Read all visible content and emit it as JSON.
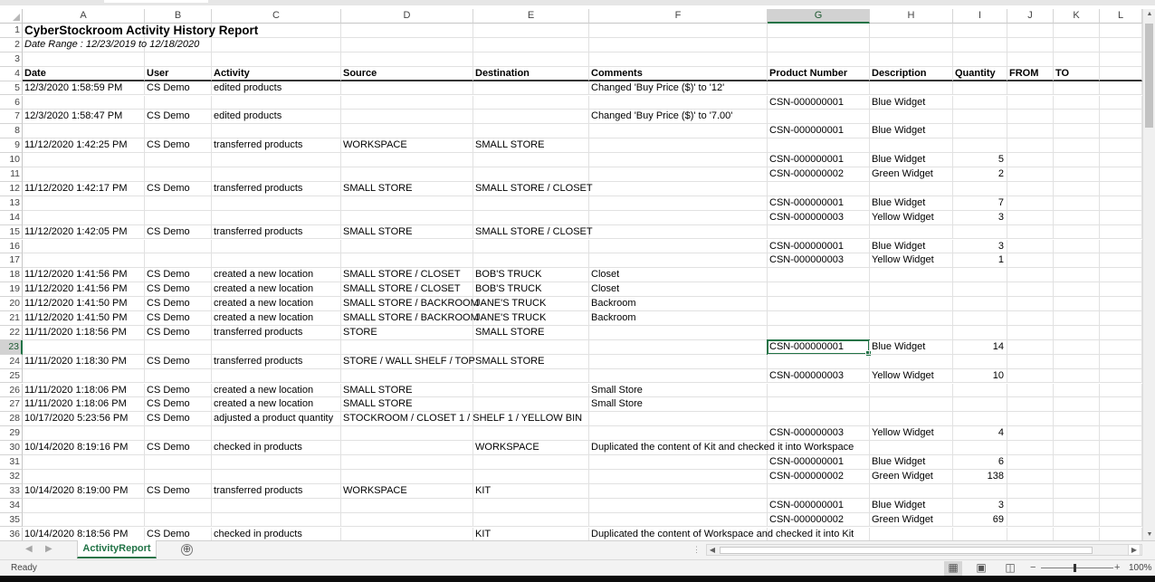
{
  "columns": [
    "A",
    "B",
    "C",
    "D",
    "E",
    "F",
    "G",
    "H",
    "I",
    "J",
    "K",
    "L"
  ],
  "rows": [
    [
      "CyberStockroom Activity History Report",
      "",
      "",
      "",
      "",
      "",
      "",
      "",
      "",
      "",
      "",
      ""
    ],
    [
      "Date Range : 12/23/2019 to 12/18/2020",
      "",
      "",
      "",
      "",
      "",
      "",
      "",
      "",
      "",
      "",
      ""
    ],
    [
      "",
      "",
      "",
      "",
      "",
      "",
      "",
      "",
      "",
      "",
      "",
      ""
    ],
    [
      "Date",
      "User",
      "Activity",
      "Source",
      "Destination",
      "Comments",
      "Product Number",
      "Description",
      "Quantity",
      "FROM",
      "TO",
      ""
    ],
    [
      "12/3/2020 1:58:59 PM",
      "CS Demo",
      "edited products",
      "",
      "",
      "Changed 'Buy Price ($)' to '12'",
      "",
      "",
      "",
      "",
      "",
      ""
    ],
    [
      "",
      "",
      "",
      "",
      "",
      "",
      "CSN-000000001",
      "Blue Widget",
      "",
      "",
      "",
      ""
    ],
    [
      "12/3/2020 1:58:47 PM",
      "CS Demo",
      "edited products",
      "",
      "",
      "Changed 'Buy Price ($)' to '7.00'",
      "",
      "",
      "",
      "",
      "",
      ""
    ],
    [
      "",
      "",
      "",
      "",
      "",
      "",
      "CSN-000000001",
      "Blue Widget",
      "",
      "",
      "",
      ""
    ],
    [
      "11/12/2020 1:42:25 PM",
      "CS Demo",
      "transferred products",
      "WORKSPACE",
      "SMALL STORE",
      "",
      "",
      "",
      "",
      "",
      "",
      ""
    ],
    [
      "",
      "",
      "",
      "",
      "",
      "",
      "CSN-000000001",
      "Blue Widget",
      "5",
      "",
      "",
      ""
    ],
    [
      "",
      "",
      "",
      "",
      "",
      "",
      "CSN-000000002",
      "Green Widget",
      "2",
      "",
      "",
      ""
    ],
    [
      "11/12/2020 1:42:17 PM",
      "CS Demo",
      "transferred products",
      "SMALL STORE",
      "SMALL STORE / CLOSET",
      "",
      "",
      "",
      "",
      "",
      "",
      ""
    ],
    [
      "",
      "",
      "",
      "",
      "",
      "",
      "CSN-000000001",
      "Blue Widget",
      "7",
      "",
      "",
      ""
    ],
    [
      "",
      "",
      "",
      "",
      "",
      "",
      "CSN-000000003",
      "Yellow Widget",
      "3",
      "",
      "",
      ""
    ],
    [
      "11/12/2020 1:42:05 PM",
      "CS Demo",
      "transferred products",
      "SMALL STORE",
      "SMALL STORE / CLOSET",
      "",
      "",
      "",
      "",
      "",
      "",
      ""
    ],
    [
      "",
      "",
      "",
      "",
      "",
      "",
      "CSN-000000001",
      "Blue Widget",
      "3",
      "",
      "",
      ""
    ],
    [
      "",
      "",
      "",
      "",
      "",
      "",
      "CSN-000000003",
      "Yellow Widget",
      "1",
      "",
      "",
      ""
    ],
    [
      "11/12/2020 1:41:56 PM",
      "CS Demo",
      "created a new location",
      "SMALL STORE / CLOSET",
      "BOB'S TRUCK",
      "Closet",
      "",
      "",
      "",
      "",
      "",
      ""
    ],
    [
      "11/12/2020 1:41:56 PM",
      "CS Demo",
      "created a new location",
      "SMALL STORE / CLOSET",
      "BOB'S TRUCK",
      "Closet",
      "",
      "",
      "",
      "",
      "",
      ""
    ],
    [
      "11/12/2020 1:41:50 PM",
      "CS Demo",
      "created a new location",
      "SMALL STORE / BACKROOM",
      "JANE'S TRUCK",
      "Backroom",
      "",
      "",
      "",
      "",
      "",
      ""
    ],
    [
      "11/12/2020 1:41:50 PM",
      "CS Demo",
      "created a new location",
      "SMALL STORE / BACKROOM",
      "JANE'S TRUCK",
      "Backroom",
      "",
      "",
      "",
      "",
      "",
      ""
    ],
    [
      "11/11/2020 1:18:56 PM",
      "CS Demo",
      "transferred products",
      "STORE",
      "SMALL STORE",
      "",
      "",
      "",
      "",
      "",
      "",
      ""
    ],
    [
      "",
      "",
      "",
      "",
      "",
      "",
      "CSN-000000001",
      "Blue Widget",
      "14",
      "",
      "",
      ""
    ],
    [
      "11/11/2020 1:18:30 PM",
      "CS Demo",
      "transferred products",
      "STORE / WALL SHELF / TOP",
      "SMALL STORE",
      "",
      "",
      "",
      "",
      "",
      "",
      ""
    ],
    [
      "",
      "",
      "",
      "",
      "",
      "",
      "CSN-000000003",
      "Yellow Widget",
      "10",
      "",
      "",
      ""
    ],
    [
      "11/11/2020 1:18:06 PM",
      "CS Demo",
      "created a new location",
      "SMALL STORE",
      "",
      "Small Store",
      "",
      "",
      "",
      "",
      "",
      ""
    ],
    [
      "11/11/2020 1:18:06 PM",
      "CS Demo",
      "created a new location",
      "SMALL STORE",
      "",
      "Small Store",
      "",
      "",
      "",
      "",
      "",
      ""
    ],
    [
      "10/17/2020 5:23:56 PM",
      "CS Demo",
      "adjusted a product quantity",
      "STOCKROOM / CLOSET 1 / SHELF 1 / YELLOW BIN",
      "",
      "",
      "",
      "",
      "",
      "",
      "",
      ""
    ],
    [
      "",
      "",
      "",
      "",
      "",
      "",
      "CSN-000000003",
      "Yellow Widget",
      "4",
      "",
      "",
      ""
    ],
    [
      "10/14/2020 8:19:16 PM",
      "CS Demo",
      "checked in products",
      "",
      "WORKSPACE",
      "Duplicated the content of Kit and checked it into Workspace",
      "",
      "",
      "",
      "",
      "",
      ""
    ],
    [
      "",
      "",
      "",
      "",
      "",
      "",
      "CSN-000000001",
      "Blue Widget",
      "6",
      "",
      "",
      ""
    ],
    [
      "",
      "",
      "",
      "",
      "",
      "",
      "CSN-000000002",
      "Green Widget",
      "138",
      "",
      "",
      ""
    ],
    [
      "10/14/2020 8:19:00 PM",
      "CS Demo",
      "transferred products",
      "WORKSPACE",
      "KIT",
      "",
      "",
      "",
      "",
      "",
      "",
      ""
    ],
    [
      "",
      "",
      "",
      "",
      "",
      "",
      "CSN-000000001",
      "Blue Widget",
      "3",
      "",
      "",
      ""
    ],
    [
      "",
      "",
      "",
      "",
      "",
      "",
      "CSN-000000002",
      "Green Widget",
      "69",
      "",
      "",
      ""
    ],
    [
      "10/14/2020 8:18:56 PM",
      "CS Demo",
      "checked in products",
      "",
      "KIT",
      "Duplicated the content of Workspace and checked it into Kit",
      "",
      "",
      "",
      "",
      "",
      ""
    ]
  ],
  "row_numbers": [
    "1",
    "2",
    "3",
    "4",
    "5",
    "6",
    "7",
    "8",
    "9",
    "10",
    "11",
    "12",
    "13",
    "14",
    "15",
    "16",
    "17",
    "18",
    "19",
    "20",
    "21",
    "22",
    "23",
    "24",
    "25",
    "26",
    "27",
    "28",
    "29",
    "30",
    "31",
    "32",
    "33",
    "34",
    "35",
    "36"
  ],
  "sheet_tabs": {
    "active": "ActivityReport",
    "add_symbol": "⊕"
  },
  "status": {
    "text": "Ready",
    "zoom": "100%",
    "zoom_minus": "−",
    "zoom_plus": "+"
  },
  "icons": {
    "view_normal": "normal-view-icon",
    "view_page_layout": "page-layout-icon",
    "view_page_break": "page-break-icon"
  },
  "colors": {
    "accent": "#217346",
    "header_selected": "#d2d2d2"
  }
}
